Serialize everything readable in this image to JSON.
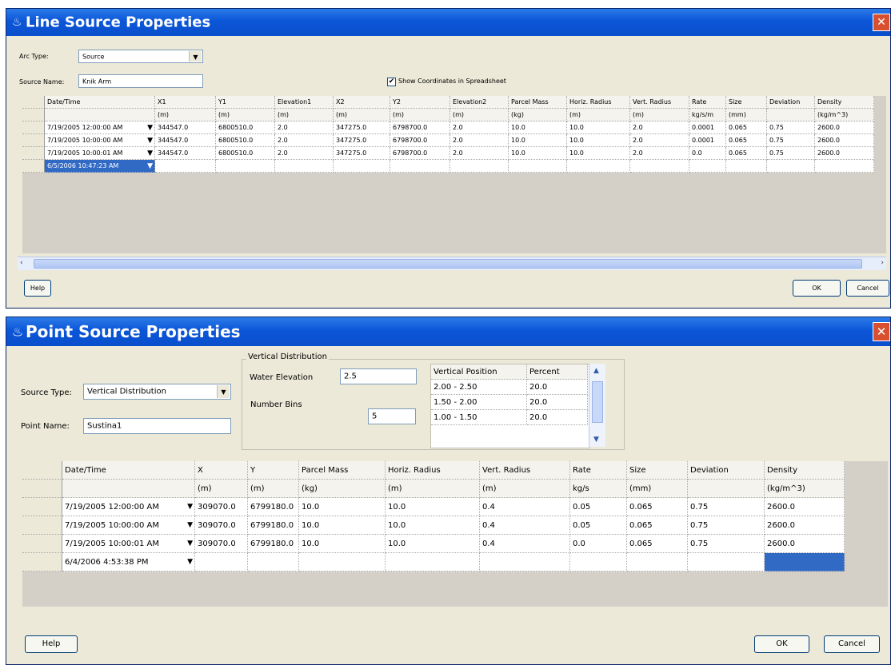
{
  "line_window": {
    "title": "Line Source Properties",
    "arc_type_label": "Arc Type:",
    "arc_type_value": "Source",
    "source_name_label": "Source Name:",
    "source_name_value": "Knik Arm",
    "show_coords_label": "Show Coordinates in Spreadsheet",
    "show_coords_checked": true,
    "headers": [
      "Date/Time",
      "X1",
      "Y1",
      "Elevation1",
      "X2",
      "Y2",
      "Elevation2",
      "Parcel Mass",
      "Horiz. Radius",
      "Vert. Radius",
      "Rate",
      "Size",
      "Deviation",
      "Density"
    ],
    "units": [
      "",
      "(m)",
      "(m)",
      "(m)",
      "(m)",
      "(m)",
      "(m)",
      "(kg)",
      "(m)",
      "(m)",
      "kg/s/m",
      "(mm)",
      "",
      "(kg/m^3)"
    ],
    "rows": [
      [
        "7/19/2005 12:00:00 AM",
        "344547.0",
        "6800510.0",
        "2.0",
        "347275.0",
        "6798700.0",
        "2.0",
        "10.0",
        "10.0",
        "2.0",
        "0.0001",
        "0.065",
        "0.75",
        "2600.0"
      ],
      [
        "7/19/2005 10:00:00 AM",
        "344547.0",
        "6800510.0",
        "2.0",
        "347275.0",
        "6798700.0",
        "2.0",
        "10.0",
        "10.0",
        "2.0",
        "0.0001",
        "0.065",
        "0.75",
        "2600.0"
      ],
      [
        "7/19/2005 10:00:01 AM",
        "344547.0",
        "6800510.0",
        "2.0",
        "347275.0",
        "6798700.0",
        "2.0",
        "10.0",
        "10.0",
        "2.0",
        "0.0",
        "0.065",
        "0.75",
        "2600.0"
      ]
    ],
    "new_row_date": "6/5/2006 10:47:23 AM",
    "help_label": "Help",
    "ok_label": "OK",
    "cancel_label": "Cancel"
  },
  "point_window": {
    "title": "Point Source Properties",
    "source_type_label": "Source Type:",
    "source_type_value": "Vertical Distribution",
    "point_name_label": "Point Name:",
    "point_name_value": "Sustina1",
    "vd_group_title": "Vertical Distribution",
    "water_elevation_label": "Water Elevation",
    "water_elevation_value": "2.5",
    "number_bins_label": "Number Bins",
    "number_bins_value": "5",
    "vd_table_headers": [
      "Vertical Position",
      "Percent"
    ],
    "vd_table_rows": [
      [
        "2.00 - 2.50",
        "20.0"
      ],
      [
        "1.50 - 2.00",
        "20.0"
      ],
      [
        "1.00 - 1.50",
        "20.0"
      ]
    ],
    "headers": [
      "Date/Time",
      "X",
      "Y",
      "Parcel Mass",
      "Horiz. Radius",
      "Vert. Radius",
      "Rate",
      "Size",
      "Deviation",
      "Density"
    ],
    "units": [
      "",
      "(m)",
      "(m)",
      "(kg)",
      "(m)",
      "(m)",
      "kg/s",
      "(mm)",
      "",
      "(kg/m^3)"
    ],
    "rows": [
      [
        "7/19/2005 12:00:00 AM",
        "309070.0",
        "6799180.0",
        "10.0",
        "10.0",
        "0.4",
        "0.05",
        "0.065",
        "0.75",
        "2600.0"
      ],
      [
        "7/19/2005 10:00:00 AM",
        "309070.0",
        "6799180.0",
        "10.0",
        "10.0",
        "0.4",
        "0.05",
        "0.065",
        "0.75",
        "2600.0"
      ],
      [
        "7/19/2005 10:00:01 AM",
        "309070.0",
        "6799180.0",
        "10.0",
        "10.0",
        "0.4",
        "0.0",
        "0.065",
        "0.75",
        "2600.0"
      ]
    ],
    "new_row_date": "6/4/2006 4:53:38 PM",
    "help_label": "Help",
    "ok_label": "OK",
    "cancel_label": "Cancel"
  },
  "icons": {
    "title_icon": "java-cup-icon",
    "close_icon": "close-icon",
    "dropdown_icon": "chevron-down-icon",
    "scroll_left_icon": "chevron-left-icon",
    "scroll_right_icon": "chevron-right-icon",
    "scroll_up_icon": "chevron-up-icon",
    "scroll_down_icon": "chevron-down-icon"
  },
  "colors": {
    "titlebar": "#0b56d8",
    "selection": "#316ac5",
    "close_button": "#d8502f",
    "dialog_bg": "#ece9d8"
  }
}
